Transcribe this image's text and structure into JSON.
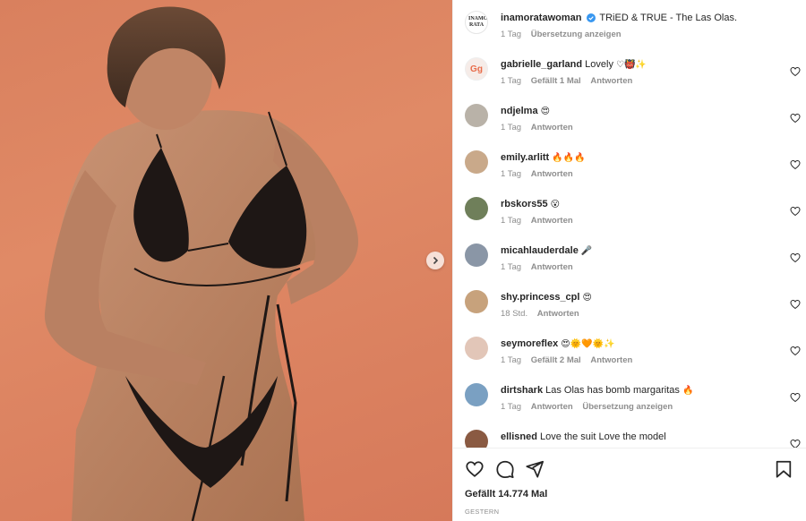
{
  "post": {
    "author": "inamorataowoman",
    "author_display": "inamoratawoman",
    "avatar_text": "INAMO RATA",
    "caption": "TRiED & TRUE - The Las Olas.",
    "time": "1 Tag",
    "translate": "Übersetzung anzeigen"
  },
  "comments": [
    {
      "user": "gabrielle_garland",
      "text": "Lovely",
      "emoji": "♡👹✨",
      "time": "1 Tag",
      "likes": "Gefällt 1 Mal",
      "reply": "Antworten",
      "avatar_color": "#f3ece8",
      "avatar_glyph": "Gg"
    },
    {
      "user": "ndjelma",
      "text": "",
      "emoji": "😍",
      "time": "1 Tag",
      "likes": "",
      "reply": "Antworten",
      "avatar_color": "#b9b2a8",
      "avatar_glyph": ""
    },
    {
      "user": "emily.arlitt",
      "text": "",
      "emoji": "🔥🔥🔥",
      "time": "1 Tag",
      "likes": "",
      "reply": "Antworten",
      "avatar_color": "#c9a98a",
      "avatar_glyph": ""
    },
    {
      "user": "rbskors55",
      "text": "",
      "emoji": "😮",
      "time": "1 Tag",
      "likes": "",
      "reply": "Antworten",
      "avatar_color": "#6f7f5a",
      "avatar_glyph": ""
    },
    {
      "user": "micahlauderdale",
      "text": "",
      "emoji": "🎤",
      "time": "1 Tag",
      "likes": "",
      "reply": "Antworten",
      "avatar_color": "#8a96a6",
      "avatar_glyph": ""
    },
    {
      "user": "shy.princess_cpl",
      "text": "",
      "emoji": "😍",
      "time": "18 Std.",
      "likes": "",
      "reply": "Antworten",
      "avatar_color": "#c7a27c",
      "avatar_glyph": ""
    },
    {
      "user": "seymoreflex",
      "text": "",
      "emoji": "😍🌞🧡🌞✨",
      "time": "1 Tag",
      "likes": "Gefällt 2 Mal",
      "reply": "Antworten",
      "avatar_color": "#e2c6b8",
      "avatar_glyph": ""
    },
    {
      "user": "dirtshark",
      "text": "Las Olas has bomb margaritas",
      "emoji": "🔥",
      "time": "1 Tag",
      "likes": "",
      "reply": "Antworten",
      "translate": "Übersetzung anzeigen",
      "avatar_color": "#7aa0c2",
      "avatar_glyph": ""
    },
    {
      "user": "ellisned",
      "text": "Love the suit Love the model",
      "emoji": "",
      "time": "",
      "likes": "",
      "reply": "",
      "avatar_color": "#8a5a42",
      "avatar_glyph": ""
    }
  ],
  "footer": {
    "likes": "Gefällt 14.774 Mal",
    "date": "GESTERN"
  },
  "colors": {
    "background_media": "#dd8462",
    "meta_text": "#8e8e8e",
    "verified": "#3897f0"
  },
  "icons": [
    "heart-icon",
    "comment-icon",
    "share-icon",
    "bookmark-icon",
    "chevron-right-icon",
    "verified-icon"
  ]
}
